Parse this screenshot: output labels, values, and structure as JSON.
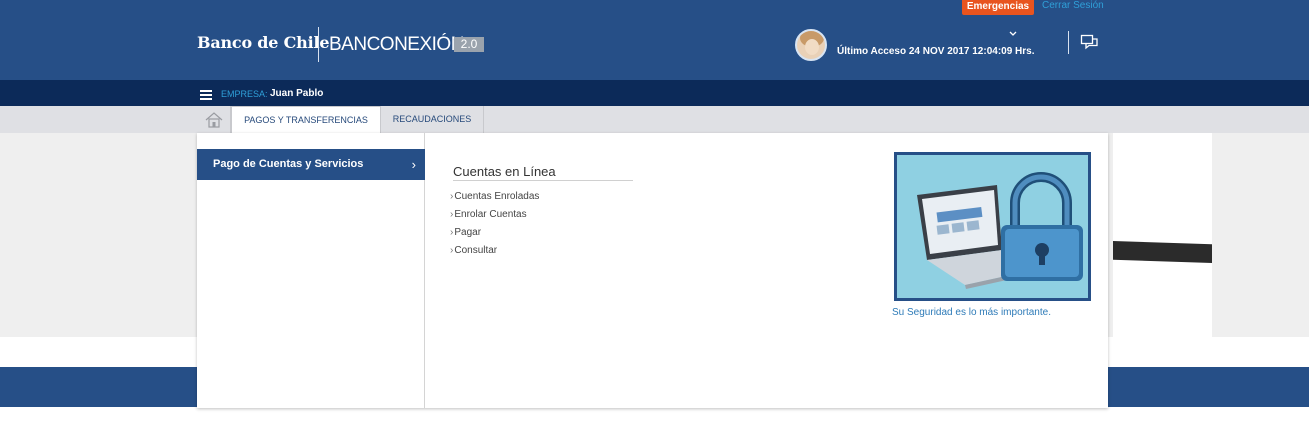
{
  "header": {
    "bank_name": "Banco de Chile",
    "product_name": "BANCONEXIÓN",
    "product_version": "2.0",
    "emergency_button": "Emergencias",
    "logout_link": "Cerrar Sesión",
    "last_access": "Último Acceso 24 NOV 2017 12:04:09 Hrs.",
    "icons": [
      "avatar",
      "chevron-down-icon",
      "chat-icon"
    ]
  },
  "company_bar": {
    "label": "EMPRESA:",
    "name": "Juan Pablo",
    "icon": "hamburger-menu-icon"
  },
  "tabs": [
    {
      "label": "PAGOS Y TRANSFERENCIAS",
      "active": true
    },
    {
      "label": "RECAUDACIONES",
      "active": false
    }
  ],
  "home_icon": "home-icon",
  "dropdown": {
    "categories": [
      {
        "label": "Pago de Cuentas y Servicios",
        "active": true
      }
    ],
    "section_title": "Cuentas en Línea",
    "links": [
      "Cuentas Enroladas",
      "Enrolar Cuentas",
      "Pagar",
      "Consultar"
    ],
    "promo_caption": "Su Seguridad es lo más importante."
  },
  "colors": {
    "header_blue": "#264f87",
    "company_bar": "#0c2a59",
    "emergency_orange": "#e8541f",
    "link_blue": "#2f9fd8"
  }
}
